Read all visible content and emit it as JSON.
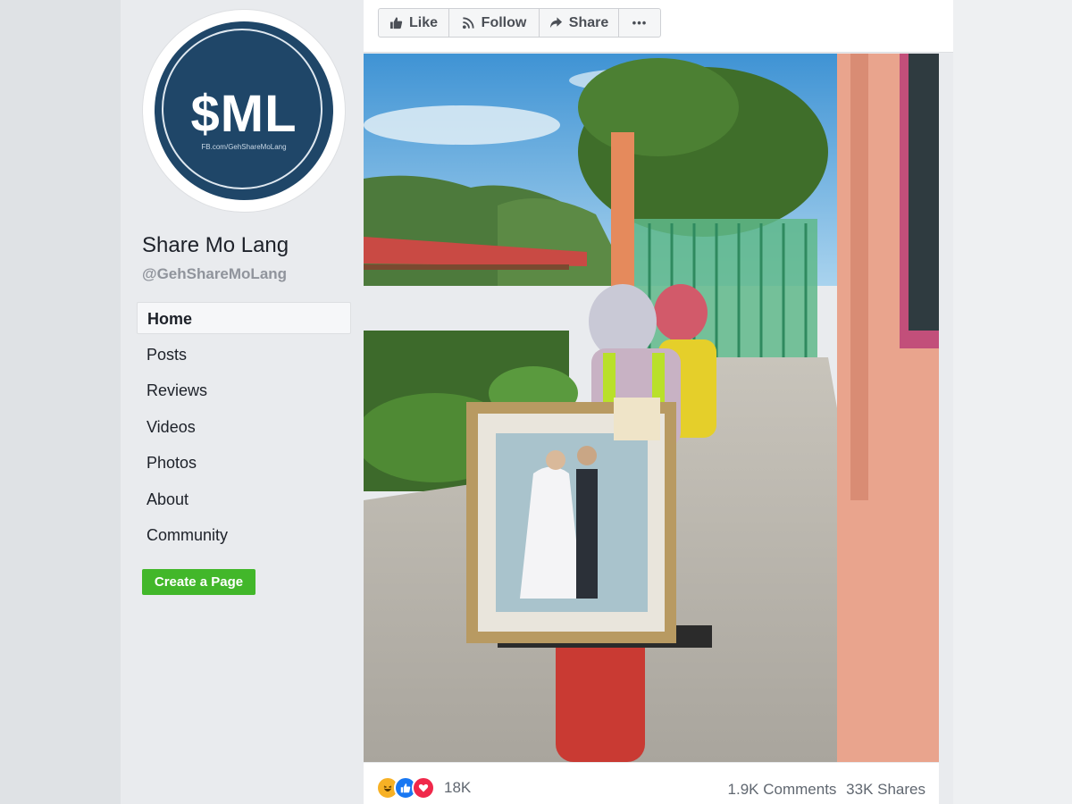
{
  "page": {
    "name": "Share Mo Lang",
    "handle": "@GehShareMoLang"
  },
  "logo": {
    "text": "$ML",
    "subtext": "FB.com/GehShareMoLang",
    "colors": {
      "disc": "#1f4668",
      "ring": "#ffffff"
    }
  },
  "sidebar": {
    "items": [
      {
        "label": "Home",
        "active": true
      },
      {
        "label": "Posts"
      },
      {
        "label": "Reviews"
      },
      {
        "label": "Videos"
      },
      {
        "label": "Photos"
      },
      {
        "label": "About"
      },
      {
        "label": "Community"
      }
    ],
    "create_button": "Create a Page"
  },
  "actions": {
    "like": {
      "label": "Like",
      "icon": "thumbs-up-icon"
    },
    "follow": {
      "label": "Follow",
      "icon": "rss-icon"
    },
    "share": {
      "label": "Share",
      "icon": "share-arrow-icon"
    },
    "more": {
      "label": "•••",
      "icon": "ellipsis-icon"
    }
  },
  "post": {
    "photo_description": "Couple on a red motorcycle carrying a framed wedding portrait",
    "reactions": {
      "icons": [
        "haha-icon",
        "like-icon",
        "love-icon"
      ],
      "count": "18K"
    },
    "comments": "1.9K Comments",
    "shares": "33K Shares"
  },
  "colors": {
    "accent_green": "#42b72a",
    "facebook_blue": "#1877f2",
    "text_primary": "#1d2129",
    "text_muted": "#90949c"
  }
}
